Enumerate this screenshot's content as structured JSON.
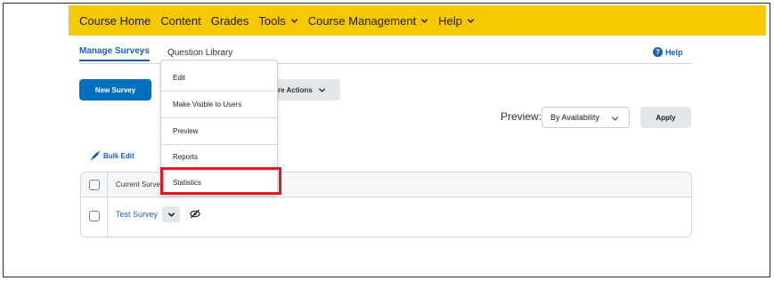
{
  "colors": {
    "nav_bg": "#f6c800",
    "primary": "#006fbf",
    "link": "#1a5fb0",
    "highlight": "#e8161e"
  },
  "nav": {
    "items": [
      {
        "label": "Course Home",
        "dropdown": false
      },
      {
        "label": "Content",
        "dropdown": false
      },
      {
        "label": "Grades",
        "dropdown": false
      },
      {
        "label": "Tools",
        "dropdown": true
      },
      {
        "label": "Course Management",
        "dropdown": true
      },
      {
        "label": "Help",
        "dropdown": true
      }
    ]
  },
  "tabs": {
    "manage": "Manage Surveys",
    "library": "Question Library"
  },
  "help_link": "Help",
  "toolbar": {
    "new_survey": "New Survey",
    "more_actions": "re Actions"
  },
  "preview": {
    "label": "Preview:",
    "selected": "By Availability",
    "apply": "Apply"
  },
  "bulk_edit": "Bulk Edit",
  "table": {
    "header": "Current Surve",
    "row_link": "Test Survey"
  },
  "menu": {
    "items": [
      "Edit",
      "Make Visible to Users",
      "Preview",
      "Reports",
      "Statistics"
    ],
    "highlighted": "Statistics"
  }
}
